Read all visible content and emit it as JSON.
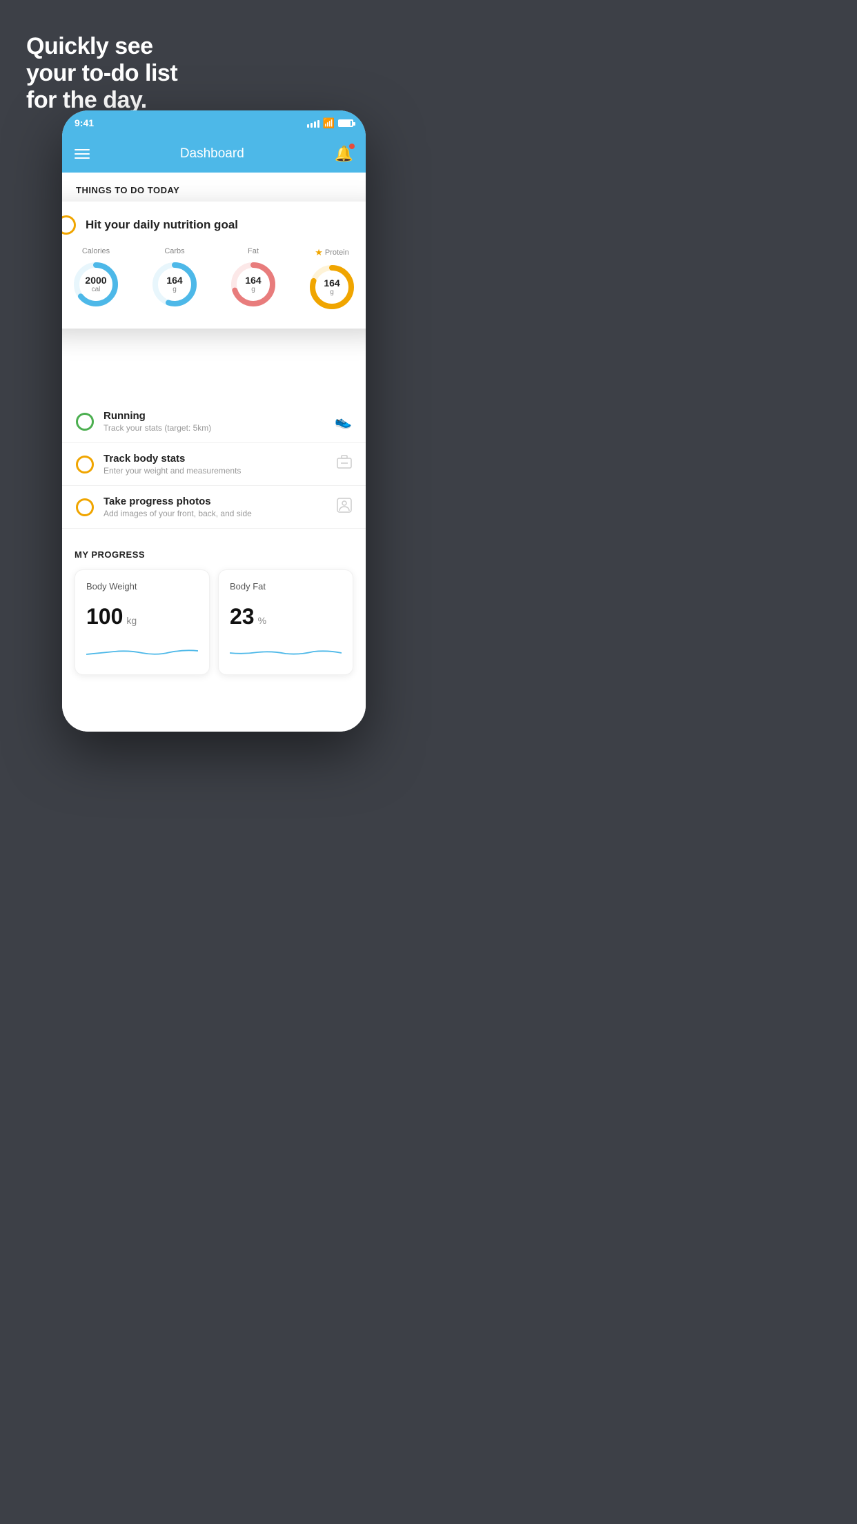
{
  "headline": {
    "line1": "Quickly see",
    "line2": "your to-do list",
    "line3": "for the day."
  },
  "statusBar": {
    "time": "9:41"
  },
  "navBar": {
    "title": "Dashboard"
  },
  "thingsToDo": {
    "sectionHeader": "THINGS TO DO TODAY"
  },
  "nutritionCard": {
    "checkIcon": "circle-check",
    "title": "Hit your daily nutrition goal",
    "items": [
      {
        "label": "Calories",
        "value": "2000",
        "unit": "cal",
        "color": "#4db8e8",
        "starred": false,
        "pct": 65
      },
      {
        "label": "Carbs",
        "value": "164",
        "unit": "g",
        "color": "#4db8e8",
        "starred": false,
        "pct": 55
      },
      {
        "label": "Fat",
        "value": "164",
        "unit": "g",
        "color": "#e87c7c",
        "starred": false,
        "pct": 70
      },
      {
        "label": "Protein",
        "value": "164",
        "unit": "g",
        "color": "#f0a500",
        "starred": true,
        "pct": 80
      }
    ]
  },
  "todoItems": [
    {
      "id": "running",
      "circleColor": "green",
      "title": "Running",
      "subtitle": "Track your stats (target: 5km)",
      "icon": "shoe"
    },
    {
      "id": "body-stats",
      "circleColor": "yellow",
      "title": "Track body stats",
      "subtitle": "Enter your weight and measurements",
      "icon": "scale"
    },
    {
      "id": "photos",
      "circleColor": "yellow",
      "title": "Take progress photos",
      "subtitle": "Add images of your front, back, and side",
      "icon": "person"
    }
  ],
  "progress": {
    "header": "MY PROGRESS",
    "cards": [
      {
        "title": "Body Weight",
        "value": "100",
        "unit": "kg"
      },
      {
        "title": "Body Fat",
        "value": "23",
        "unit": "%"
      }
    ]
  }
}
